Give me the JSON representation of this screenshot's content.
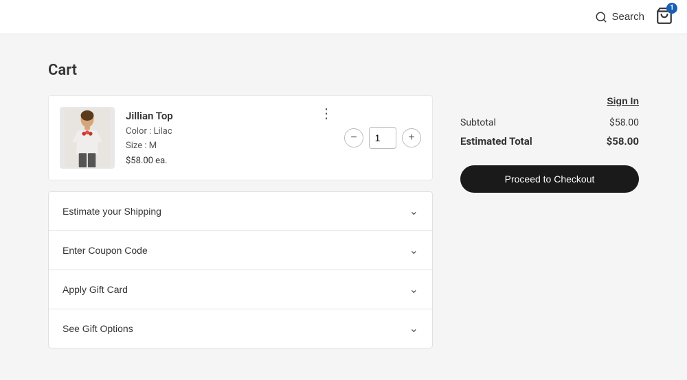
{
  "header": {
    "search_label": "Search",
    "cart_count": "1"
  },
  "page": {
    "title": "Cart",
    "sign_in_label": "Sign In"
  },
  "cart_item": {
    "name": "Jillian Top",
    "color_label": "Color : Lilac",
    "size_label": "Size : M",
    "price_label": "$58.00 ea.",
    "quantity": "1"
  },
  "summary": {
    "subtotal_label": "Subtotal",
    "subtotal_value": "$58.00",
    "total_label": "Estimated Total",
    "total_value": "$58.00",
    "checkout_label": "Proceed to Checkout"
  },
  "accordion": {
    "items": [
      {
        "label": "Estimate your Shipping"
      },
      {
        "label": "Enter Coupon Code"
      },
      {
        "label": "Apply Gift Card"
      },
      {
        "label": "See Gift Options"
      }
    ]
  }
}
